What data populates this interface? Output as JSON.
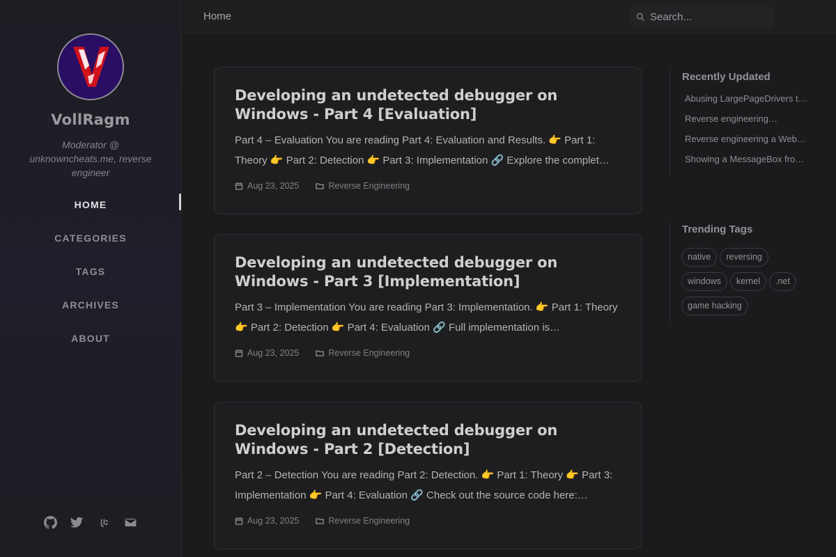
{
  "sidebar": {
    "site_title": "VollRagm",
    "site_subtitle": "Moderator @ unknowncheats.me, reverse engineer",
    "nav": [
      {
        "label": "HOME",
        "active": true
      },
      {
        "label": "CATEGORIES",
        "active": false
      },
      {
        "label": "TAGS",
        "active": false
      },
      {
        "label": "ARCHIVES",
        "active": false
      },
      {
        "label": "ABOUT",
        "active": false
      }
    ],
    "social_icons": [
      "github-icon",
      "twitter-icon",
      "unknowncheats-icon",
      "email-icon"
    ]
  },
  "topbar": {
    "breadcrumb": "Home",
    "search_placeholder": "Search..."
  },
  "posts": [
    {
      "title": "Developing an undetected debugger on Windows - Part 4 [Evaluation]",
      "excerpt": "Part 4 – Evaluation You are reading Part 4: Evaluation and Results. 👉 Part 1: Theory 👉 Part 2: Detection 👉 Part 3: Implementation 🔗 Explore the complet…",
      "date": "Aug 23, 2025",
      "category": "Reverse Engineering"
    },
    {
      "title": "Developing an undetected debugger on Windows - Part 3 [Implementation]",
      "excerpt": "Part 3 – Implementation You are reading Part 3: Implementation. 👉 Part 1: Theory 👉 Part 2: Detection 👉 Part 4: Evaluation 🔗 Full implementation is…",
      "date": "Aug 23, 2025",
      "category": "Reverse Engineering"
    },
    {
      "title": "Developing an undetected debugger on Windows - Part 2 [Detection]",
      "excerpt": "Part 2 – Detection You are reading Part 2: Detection. 👉 Part 1: Theory 👉 Part 3: Implementation 👉 Part 4: Evaluation 🔗 Check out the source code here:…",
      "date": "Aug 23, 2025",
      "category": "Reverse Engineering"
    }
  ],
  "recently_updated": {
    "title": "Recently Updated",
    "items": [
      "Abusing LargePageDrivers t…",
      "Reverse engineering…",
      "Reverse engineering a Web…",
      "Showing a MessageBox fro…"
    ]
  },
  "trending_tags": {
    "title": "Trending Tags",
    "items": [
      "native",
      "reversing",
      "windows",
      "kernel",
      ".net",
      "game hacking"
    ]
  },
  "colors": {
    "background": "#1b1b1e",
    "sidebar": "#1e1e26",
    "avatar_bg": "#2a0e63",
    "avatar_accent": "#d0121b"
  }
}
